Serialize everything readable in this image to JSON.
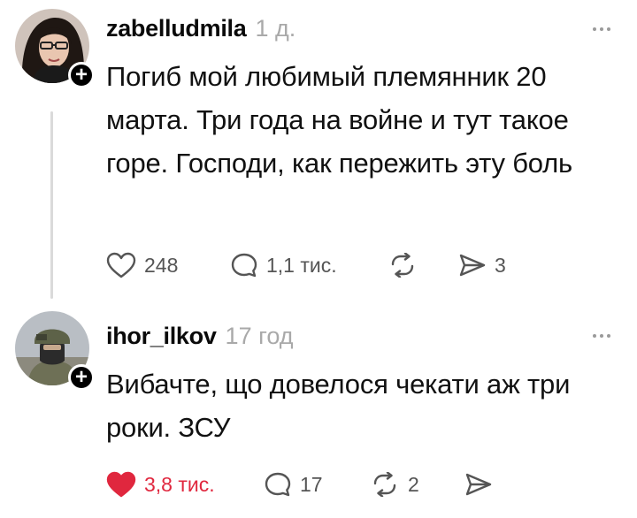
{
  "comments": [
    {
      "username": "zabelludmila",
      "time": "1 д.",
      "text": "Погиб мой любимый племянник  20 марта. Три года на войне и тут такое горе. Господи, как пережить эту боль",
      "likes": "248",
      "replies": "1,1 тис.",
      "reposts": "",
      "shares": "3",
      "liked": false,
      "avatar_icon": "woman-avatar",
      "badge_icon": "plus-icon"
    },
    {
      "username": "ihor_ilkov",
      "time": "17 год",
      "text": "Вибачте, що довелося чекати аж три роки. ЗСУ",
      "likes": "3,8 тис.",
      "replies": "17",
      "reposts": "2",
      "shares": "",
      "liked": true,
      "avatar_icon": "soldier-avatar",
      "badge_icon": "plus-icon"
    }
  ],
  "colors": {
    "like_active": "#e0273e",
    "muted_text": "#a9a9a9",
    "icon_gray": "#555555",
    "thread_line": "#dadada"
  }
}
